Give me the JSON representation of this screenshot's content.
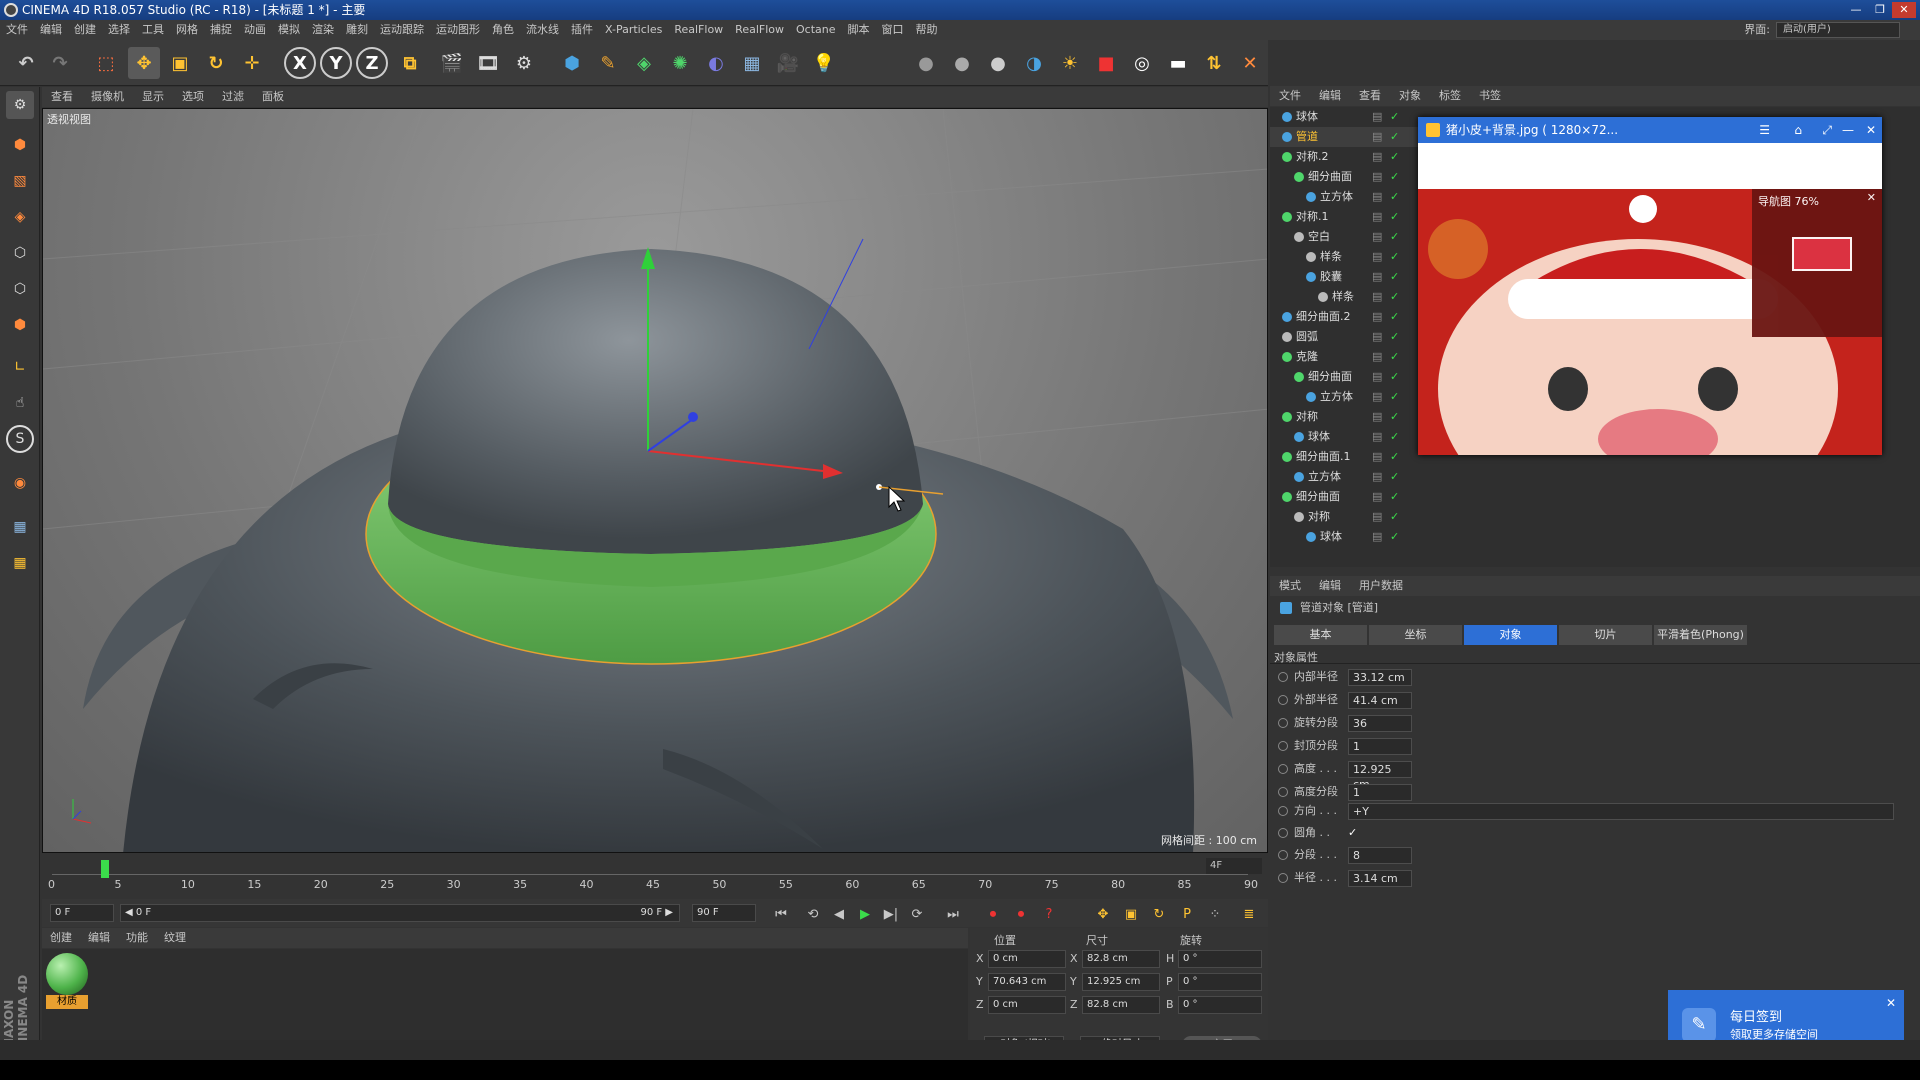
{
  "window": {
    "title": "CINEMA 4D R18.057 Studio (RC - R18) - [未标题 1 *] - 主要"
  },
  "menubar": {
    "items": [
      "文件",
      "编辑",
      "创建",
      "选择",
      "工具",
      "网格",
      "捕捉",
      "动画",
      "模拟",
      "渲染",
      "雕刻",
      "运动跟踪",
      "运动图形",
      "角色",
      "流水线",
      "插件",
      "X-Particles",
      "RealFlow",
      "RealFlow",
      "Octane",
      "脚本",
      "窗口",
      "帮助"
    ],
    "layout_label": "界面:",
    "layout_value": "启动(用户)"
  },
  "toolbar": {
    "icons": [
      "undo-icon",
      "redo-icon",
      "select-icon",
      "move-icon",
      "scale-icon",
      "rotate-icon",
      "universal-icon",
      "x-axis-icon",
      "y-axis-icon",
      "z-axis-icon",
      "coordinate-icon",
      "render-view-icon",
      "render-picture-icon",
      "render-settings-icon",
      "cube-icon",
      "pen-icon",
      "subdivision-icon",
      "array-icon",
      "deformer-icon",
      "floor-icon",
      "camera-icon",
      "light-icon"
    ],
    "axis_labels": [
      "X",
      "Y",
      "Z"
    ]
  },
  "viewport": {
    "menu": [
      "查看",
      "摄像机",
      "显示",
      "选项",
      "过滤",
      "面板"
    ],
    "label": "透视视图",
    "grid_spacing": "网格间距 : 100 cm"
  },
  "timeline": {
    "ticks": [
      "0",
      "5",
      "10",
      "15",
      "20",
      "25",
      "30",
      "35",
      "40",
      "45",
      "50",
      "55",
      "60",
      "65",
      "70",
      "75",
      "80",
      "85",
      "90"
    ],
    "current_frame_label": "4F",
    "start_field": "0 F",
    "range_start": "◀ 0 F",
    "range_end": "90 F ▶",
    "end_field": "90 F",
    "current_frame": 4,
    "max_frame": 90
  },
  "material_manager": {
    "menu": [
      "创建",
      "编辑",
      "功能",
      "纹理"
    ],
    "materials": [
      {
        "label": "材质"
      }
    ]
  },
  "coordinates": {
    "headers": [
      "位置",
      "尺寸",
      "旋转"
    ],
    "rows": [
      {
        "axis": "X",
        "pos": "0 cm",
        "size_axis": "X",
        "size": "82.8 cm",
        "rot_axis": "H",
        "rot": "0 °"
      },
      {
        "axis": "Y",
        "pos": "70.643 cm",
        "size_axis": "Y",
        "size": "12.925 cm",
        "rot_axis": "P",
        "rot": "0 °"
      },
      {
        "axis": "Z",
        "pos": "0 cm",
        "size_axis": "Z",
        "size": "82.8 cm",
        "rot_axis": "B",
        "rot": "0 °"
      }
    ],
    "mode1": "对象 (相对)",
    "mode2": "绝对尺寸",
    "apply": "应用"
  },
  "object_manager": {
    "menu": [
      "文件",
      "编辑",
      "查看",
      "对象",
      "标签",
      "书签"
    ],
    "objects": [
      {
        "name": "球体",
        "indent": 0,
        "color": "#4aa3e0"
      },
      {
        "name": "管道",
        "indent": 0,
        "color": "#4aa3e0",
        "selected": true
      },
      {
        "name": "对称.2",
        "indent": 0,
        "color": "#4fd66b"
      },
      {
        "name": "细分曲面",
        "indent": 1,
        "color": "#4fd66b"
      },
      {
        "name": "立方体",
        "indent": 2,
        "color": "#4aa3e0"
      },
      {
        "name": "对称.1",
        "indent": 0,
        "color": "#4fd66b"
      },
      {
        "name": "空白",
        "indent": 1,
        "color": "#bbbbbb"
      },
      {
        "name": "样条",
        "indent": 2,
        "color": "#bbbbbb"
      },
      {
        "name": "胶囊",
        "indent": 2,
        "color": "#4aa3e0"
      },
      {
        "name": "样条",
        "indent": 3,
        "color": "#bbbbbb"
      },
      {
        "name": "细分曲面.2",
        "indent": 0,
        "color": "#4aa3e0"
      },
      {
        "name": "圆弧",
        "indent": 0,
        "color": "#bbbbbb"
      },
      {
        "name": "克隆",
        "indent": 0,
        "color": "#4fd66b"
      },
      {
        "name": "细分曲面",
        "indent": 1,
        "color": "#4fd66b"
      },
      {
        "name": "立方体",
        "indent": 2,
        "color": "#4aa3e0"
      },
      {
        "name": "对称",
        "indent": 0,
        "color": "#4fd66b"
      },
      {
        "name": "球体",
        "indent": 1,
        "color": "#4aa3e0"
      },
      {
        "name": "细分曲面.1",
        "indent": 0,
        "color": "#4fd66b"
      },
      {
        "name": "立方体",
        "indent": 1,
        "color": "#4aa3e0"
      },
      {
        "name": "细分曲面",
        "indent": 0,
        "color": "#4fd66b"
      },
      {
        "name": "对称",
        "indent": 1,
        "color": "#bbbbbb"
      },
      {
        "name": "球体",
        "indent": 2,
        "color": "#4aa3e0"
      }
    ]
  },
  "picture_viewer": {
    "title": "猪小皮+背景.jpg ( 1280×72...",
    "navigator_label": "导航图 76%"
  },
  "attribute_manager": {
    "menu": [
      "模式",
      "编辑",
      "用户数据"
    ],
    "object_title": "管道对象 [管道]",
    "tabs": [
      "基本",
      "坐标",
      "对象",
      "切片",
      "平滑着色(Phong)"
    ],
    "active_tab": 2,
    "section": "对象属性",
    "props": [
      {
        "label": "内部半径",
        "value": "33.12 cm"
      },
      {
        "label": "外部半径",
        "value": "41.4 cm"
      },
      {
        "label": "旋转分段",
        "value": "36"
      },
      {
        "label": "封顶分段",
        "value": "1"
      },
      {
        "label": "高度 . . .",
        "value": "12.925 cm"
      },
      {
        "label": "高度分段",
        "value": "1"
      }
    ],
    "direction_label": "方向 . . .",
    "direction_value": "+Y",
    "fillet_label": "圆角 . .",
    "fillet_checked": "✓",
    "props2": [
      {
        "label": "分段 . . .",
        "value": "8"
      },
      {
        "label": "半径 . . .",
        "value": "3.14 cm"
      }
    ]
  },
  "toast": {
    "title": "每日签到",
    "subtitle": "领取更多存储空间"
  },
  "side_brand": "MAXON CINEMA 4D",
  "colors": {
    "accent": "#2d6fd6",
    "ring_green": "#6cbf5e",
    "selection_orange": "#e8a030"
  }
}
